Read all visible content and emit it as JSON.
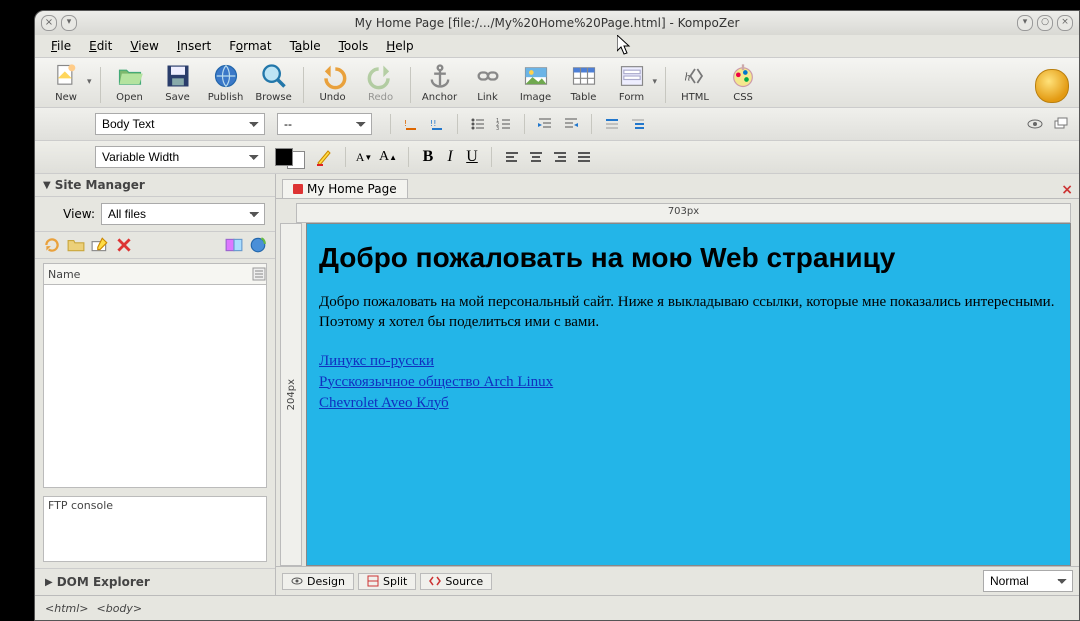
{
  "titlebar": {
    "title": "My Home Page [file:/.../My%20Home%20Page.html] - KompoZer"
  },
  "menubar": {
    "file": "File",
    "edit": "Edit",
    "view": "View",
    "insert": "Insert",
    "format": "Format",
    "table": "Table",
    "tools": "Tools",
    "help": "Help"
  },
  "toolbar": {
    "new": "New",
    "open": "Open",
    "save": "Save",
    "publish": "Publish",
    "browse": "Browse",
    "undo": "Undo",
    "redo": "Redo",
    "anchor": "Anchor",
    "link": "Link",
    "image": "Image",
    "table": "Table",
    "form": "Form",
    "html": "HTML",
    "css": "CSS"
  },
  "format_dropdowns": {
    "paragraph": "Body Text",
    "class": "--",
    "font": "Variable Width"
  },
  "ruler": {
    "horizontal": "703px",
    "vertical": "204px"
  },
  "site_manager": {
    "title": "Site Manager",
    "view_label": "View:",
    "view_value": "All files",
    "name_header": "Name",
    "ftp_console": "FTP console",
    "dom_explorer": "DOM Explorer"
  },
  "tabs": {
    "document": "My Home Page",
    "design": "Design",
    "split": "Split",
    "source": "Source",
    "zoom": "Normal"
  },
  "page": {
    "heading": "Добро пожаловать на мою Web страницу",
    "paragraph": "Добро пожаловать на мой персональный сайт. Ниже я выкладываю ссылки, которые мне показались интересными. Поэтому я хотел бы поделиться ими с вами.",
    "links": [
      "Линукс по-русски",
      "Русскоязычное общество Arch Linux",
      "Chevrolet Aveo Клуб"
    ]
  },
  "statusbar": {
    "crumb1": "<html>",
    "crumb2": "<body>"
  }
}
